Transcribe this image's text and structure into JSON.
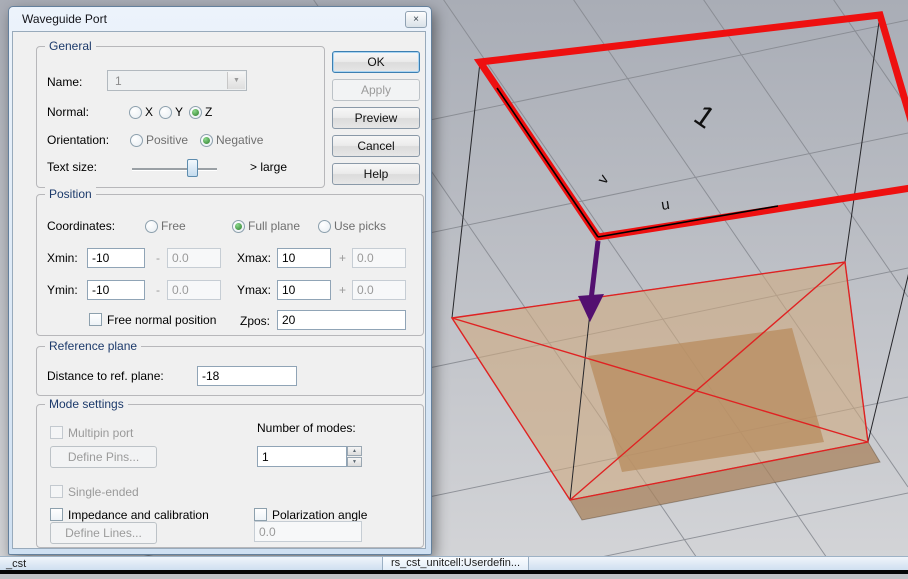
{
  "icons": {
    "close": "×",
    "combo_arrow": "▼",
    "spin_up": "▲",
    "spin_down": "▼"
  },
  "dialog": {
    "title": "Waveguide Port",
    "buttons": {
      "ok": "OK",
      "apply": "Apply",
      "preview": "Preview",
      "cancel": "Cancel",
      "help": "Help"
    },
    "general": {
      "label": "General",
      "name_label": "Name:",
      "name_value": "1",
      "normal_label": "Normal:",
      "normal_x": "X",
      "normal_y": "Y",
      "normal_z": "Z",
      "orientation_label": "Orientation:",
      "orientation_positive": "Positive",
      "orientation_negative": "Negative",
      "text_size_label": "Text size:",
      "text_size_hint": "> large"
    },
    "position": {
      "label": "Position",
      "coordinates_label": "Coordinates:",
      "coord_free": "Free",
      "coord_full_plane": "Full plane",
      "coord_use_picks": "Use picks",
      "xmin_label": "Xmin:",
      "xmin_value": "-10",
      "xmin_minus": "-",
      "xmin_offset": "0.0",
      "xmax_label": "Xmax:",
      "xmax_value": "10",
      "xmax_plus": "+",
      "xmax_offset": "0.0",
      "ymin_label": "Ymin:",
      "ymin_value": "-10",
      "ymin_minus": "-",
      "ymin_offset": "0.0",
      "ymax_label": "Ymax:",
      "ymax_value": "10",
      "ymax_plus": "+",
      "ymax_offset": "0.0",
      "free_normal_label": "Free normal position",
      "zpos_label": "Zpos:",
      "zpos_value": "20"
    },
    "reference": {
      "label": "Reference plane",
      "distance_label": "Distance to ref. plane:",
      "distance_value": "-18"
    },
    "modes": {
      "label": "Mode settings",
      "multipin_label": "Multipin port",
      "define_pins_label": "Define Pins...",
      "number_of_modes_label": "Number of modes:",
      "number_of_modes_value": "1",
      "single_ended_label": "Single-ended",
      "impedance_label": "Impedance and calibration",
      "polarization_label": "Polarization angle",
      "polarization_value": "0.0",
      "define_lines_label": "Define Lines..."
    }
  },
  "viewport": {
    "port_label": "1",
    "axis_u_label": "u",
    "axis_v_label": "v",
    "port_color": "#ee1010",
    "arrow_color": "#531070"
  },
  "statusbar": {
    "left_text": "_cst",
    "caption": "rs_cst_unitcell:Userdefin..."
  }
}
